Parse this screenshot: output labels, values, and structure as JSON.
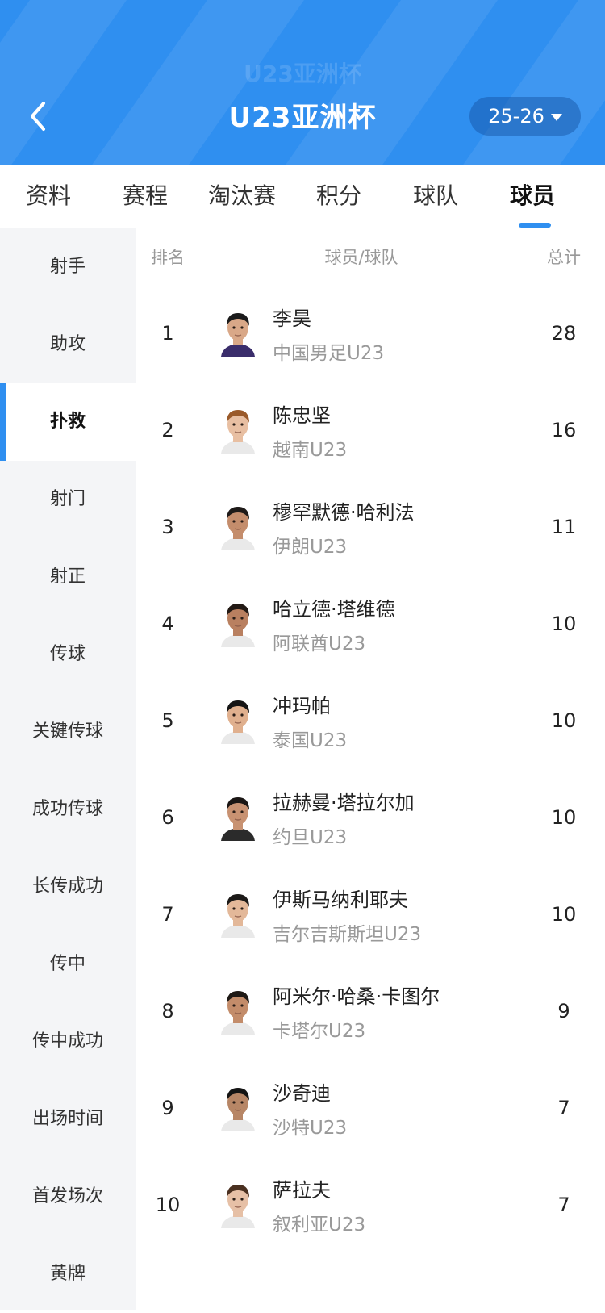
{
  "header": {
    "watermark": "U23亚洲杯",
    "title": "U23亚洲杯",
    "season": "25-26"
  },
  "tabs": [
    {
      "label": "资料"
    },
    {
      "label": "赛程"
    },
    {
      "label": "淘汰赛"
    },
    {
      "label": "积分"
    },
    {
      "label": "球队"
    },
    {
      "label": "球员",
      "active": true
    }
  ],
  "side_menu": [
    {
      "label": "射手"
    },
    {
      "label": "助攻"
    },
    {
      "label": "扑救",
      "active": true
    },
    {
      "label": "射门"
    },
    {
      "label": "射正"
    },
    {
      "label": "传球"
    },
    {
      "label": "关键传球"
    },
    {
      "label": "成功传球"
    },
    {
      "label": "长传成功"
    },
    {
      "label": "传中"
    },
    {
      "label": "传中成功"
    },
    {
      "label": "出场时间"
    },
    {
      "label": "首发场次"
    },
    {
      "label": "黄牌"
    }
  ],
  "table": {
    "headers": {
      "rank": "排名",
      "player": "球员/球队",
      "total": "总计"
    },
    "rows": [
      {
        "rank": "1",
        "name": "李昊",
        "team": "中国男足U23",
        "total": "28",
        "skin": "#d9a888",
        "hair": "#1b1b1b",
        "kit": "#3a2d6b"
      },
      {
        "rank": "2",
        "name": "陈忠坚",
        "team": "越南U23",
        "total": "16",
        "skin": "#e8bfa2",
        "hair": "#9a5a2a",
        "kit": "#e9e9e9"
      },
      {
        "rank": "3",
        "name": "穆罕默德·哈利法",
        "team": "伊朗U23",
        "total": "11",
        "skin": "#c48d6c",
        "hair": "#1e1a18",
        "kit": "#e9e9e9"
      },
      {
        "rank": "4",
        "name": "哈立德·塔维德",
        "team": "阿联酋U23",
        "total": "10",
        "skin": "#b98060",
        "hair": "#231a15",
        "kit": "#e9e9e9"
      },
      {
        "rank": "5",
        "name": "冲玛帕",
        "team": "泰国U23",
        "total": "10",
        "skin": "#e0b08e",
        "hair": "#151515",
        "kit": "#e9e9e9"
      },
      {
        "rank": "6",
        "name": "拉赫曼·塔拉尔加",
        "team": "约旦U23",
        "total": "10",
        "skin": "#c89272",
        "hair": "#1a1614",
        "kit": "#2b2b2b"
      },
      {
        "rank": "7",
        "name": "伊斯马纳利耶夫",
        "team": "吉尔吉斯斯坦U23",
        "total": "10",
        "skin": "#e3b899",
        "hair": "#1c1a18",
        "kit": "#e9e9e9"
      },
      {
        "rank": "8",
        "name": "阿米尔·哈桑·卡图尔",
        "team": "卡塔尔U23",
        "total": "9",
        "skin": "#c38c6a",
        "hair": "#1e1915",
        "kit": "#e9e9e9"
      },
      {
        "rank": "9",
        "name": "沙奇迪",
        "team": "沙特U23",
        "total": "7",
        "skin": "#b78666",
        "hair": "#141414",
        "kit": "#e9e9e9"
      },
      {
        "rank": "10",
        "name": "萨拉夫",
        "team": "叙利亚U23",
        "total": "7",
        "skin": "#e6c0a6",
        "hair": "#4a3020",
        "kit": "#e9e9e9"
      }
    ]
  },
  "colors": {
    "accent": "#2f8ff0",
    "header_bg": "#2f8ff0",
    "muted_text": "#999999"
  }
}
